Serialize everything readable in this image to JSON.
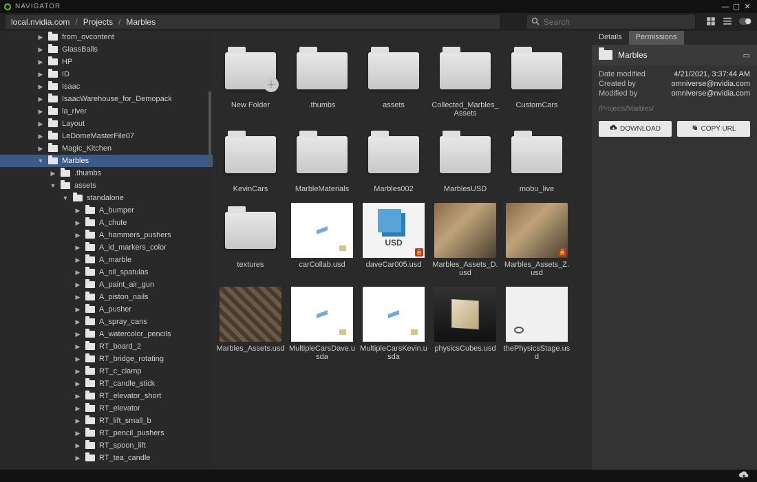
{
  "app": {
    "title": "NAVIGATOR"
  },
  "path": {
    "seg0": "local.nvidia.com",
    "seg1": "Projects",
    "seg2": "Marbles"
  },
  "search": {
    "placeholder": "Search"
  },
  "tree": [
    {
      "indent": 3,
      "arrow": "▶",
      "name": "from_ovcontent"
    },
    {
      "indent": 3,
      "arrow": "▶",
      "name": "GlassBalls"
    },
    {
      "indent": 3,
      "arrow": "▶",
      "name": "HP"
    },
    {
      "indent": 3,
      "arrow": "▶",
      "name": "ID"
    },
    {
      "indent": 3,
      "arrow": "▶",
      "name": "Isaac"
    },
    {
      "indent": 3,
      "arrow": "▶",
      "name": "IsaacWarehouse_for_Demopack"
    },
    {
      "indent": 3,
      "arrow": "▶",
      "name": "la_river"
    },
    {
      "indent": 3,
      "arrow": "▶",
      "name": "Layout"
    },
    {
      "indent": 3,
      "arrow": "▶",
      "name": "LeDomeMasterFile07"
    },
    {
      "indent": 3,
      "arrow": "▶",
      "name": "Magic_Kitchen"
    },
    {
      "indent": 3,
      "arrow": "▼",
      "name": "Marbles",
      "sel": true
    },
    {
      "indent": 4,
      "arrow": "▶",
      "name": ".thumbs"
    },
    {
      "indent": 4,
      "arrow": "▼",
      "name": "assets"
    },
    {
      "indent": 5,
      "arrow": "▼",
      "name": "standalone"
    },
    {
      "indent": 6,
      "arrow": "▶",
      "name": "A_bumper"
    },
    {
      "indent": 6,
      "arrow": "▶",
      "name": "A_chute"
    },
    {
      "indent": 6,
      "arrow": "▶",
      "name": "A_hammers_pushers"
    },
    {
      "indent": 6,
      "arrow": "▶",
      "name": "A_id_markers_color"
    },
    {
      "indent": 6,
      "arrow": "▶",
      "name": "A_marble"
    },
    {
      "indent": 6,
      "arrow": "▶",
      "name": "A_oil_spatulas"
    },
    {
      "indent": 6,
      "arrow": "▶",
      "name": "A_paint_air_gun"
    },
    {
      "indent": 6,
      "arrow": "▶",
      "name": "A_piston_nails"
    },
    {
      "indent": 6,
      "arrow": "▶",
      "name": "A_pusher"
    },
    {
      "indent": 6,
      "arrow": "▶",
      "name": "A_spray_cans"
    },
    {
      "indent": 6,
      "arrow": "▶",
      "name": "A_watercolor_pencils"
    },
    {
      "indent": 6,
      "arrow": "▶",
      "name": "RT_board_2"
    },
    {
      "indent": 6,
      "arrow": "▶",
      "name": "RT_bridge_rotating"
    },
    {
      "indent": 6,
      "arrow": "▶",
      "name": "RT_c_clamp"
    },
    {
      "indent": 6,
      "arrow": "▶",
      "name": "RT_candle_stick"
    },
    {
      "indent": 6,
      "arrow": "▶",
      "name": "RT_elevator_short"
    },
    {
      "indent": 6,
      "arrow": "▶",
      "name": "RT_elevator"
    },
    {
      "indent": 6,
      "arrow": "▶",
      "name": "RT_lift_small_b"
    },
    {
      "indent": 6,
      "arrow": "▶",
      "name": "RT_pencil_pushers"
    },
    {
      "indent": 6,
      "arrow": "▶",
      "name": "RT_spoon_lift"
    },
    {
      "indent": 6,
      "arrow": "▶",
      "name": "RT_tea_candle"
    }
  ],
  "grid": [
    {
      "type": "newfolder",
      "name": "New Folder"
    },
    {
      "type": "folder",
      "name": ".thumbs"
    },
    {
      "type": "folder",
      "name": "assets"
    },
    {
      "type": "folder",
      "name": "Collected_Marbles_Assets"
    },
    {
      "type": "folder",
      "name": "CustomCars"
    },
    {
      "type": "folder",
      "name": "KevinCars"
    },
    {
      "type": "folder",
      "name": "MarbleMaterials"
    },
    {
      "type": "folder",
      "name": "Marbles002"
    },
    {
      "type": "folder",
      "name": "MarblesUSD"
    },
    {
      "type": "folder",
      "name": "mobu_live"
    },
    {
      "type": "folder",
      "name": "textures"
    },
    {
      "type": "whitefile",
      "name": "carCollab.usd"
    },
    {
      "type": "usdfile",
      "name": "daveCar005.usd",
      "lock": true
    },
    {
      "type": "img_a",
      "name": "Marbles_Assets_D.usd"
    },
    {
      "type": "img_a",
      "name": "Marbles_Assets_Z.usd",
      "lock": true
    },
    {
      "type": "img_c",
      "name": "Marbles_Assets.usd"
    },
    {
      "type": "whitefile",
      "name": "MultipleCarsDave.usda"
    },
    {
      "type": "whitefile",
      "name": "MultipleCarsKevin.usda"
    },
    {
      "type": "cube",
      "name": "physicsCubes.usd"
    },
    {
      "type": "whitefile2",
      "name": "thePhysicsStage.usd"
    }
  ],
  "details": {
    "tabs": {
      "a": "Details",
      "b": "Permissions"
    },
    "title": "Marbles",
    "rows": [
      {
        "k": "Date modified",
        "v": "4/21/2021, 3:37:44 AM"
      },
      {
        "k": "Created by",
        "v": "omniverse@nvidia.com"
      },
      {
        "k": "Modified by",
        "v": "omniverse@nvidia.com"
      }
    ],
    "path": "/Projects/Marbles/",
    "download": "DOWNLOAD",
    "copy": "COPY URL"
  }
}
